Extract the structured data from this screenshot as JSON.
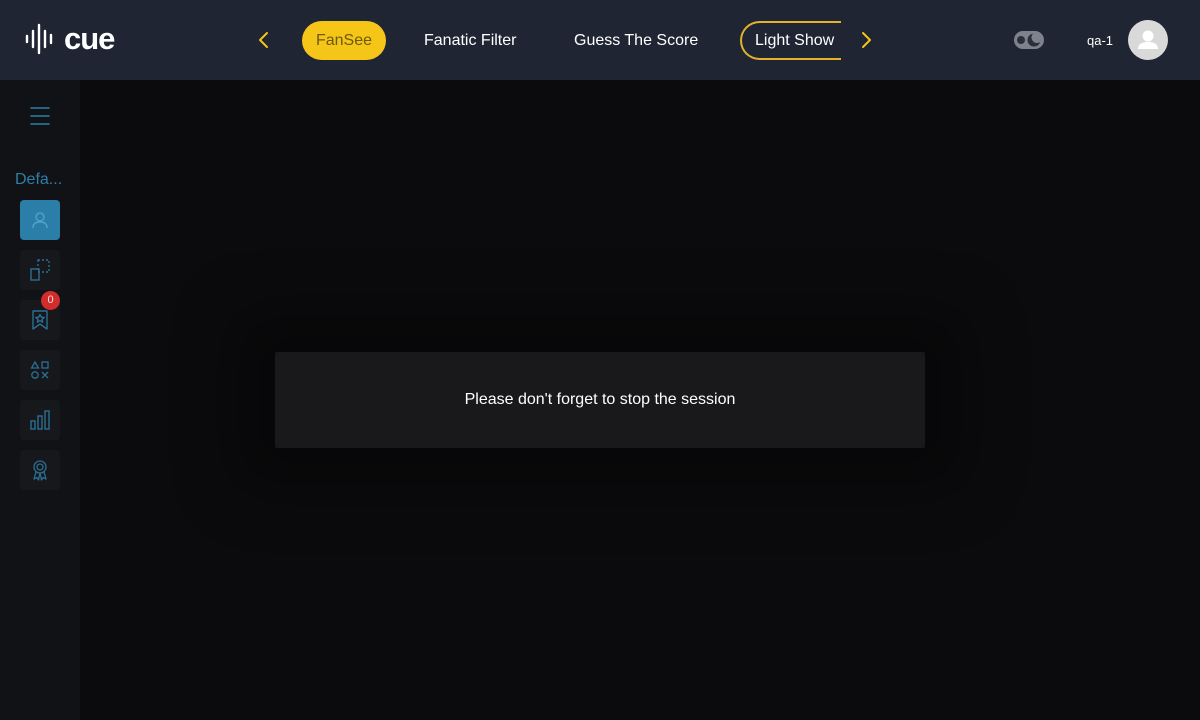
{
  "brand": {
    "logo_text": "cue"
  },
  "header": {
    "tabs": [
      {
        "label": "FanSee",
        "state": "active"
      },
      {
        "label": "Fanatic Filter",
        "state": "default"
      },
      {
        "label": "Guess The Score",
        "state": "default"
      },
      {
        "label": "Light Show",
        "state": "outlined"
      }
    ],
    "prev_icon": "chevron-left-icon",
    "next_icon": "chevron-right-icon",
    "theme_toggle_icon": "moon-icon",
    "username": "qa-1",
    "avatar_icon": "user-icon"
  },
  "sidebar": {
    "menu_icon": "hamburger-icon",
    "title": "Defa...",
    "items": [
      {
        "icon": "user-icon",
        "active": true
      },
      {
        "icon": "screen-switch-icon",
        "active": false
      },
      {
        "icon": "bookmark-star-icon",
        "active": false,
        "badge": "0"
      },
      {
        "icon": "shapes-icon",
        "active": false
      },
      {
        "icon": "bar-chart-icon",
        "active": false
      },
      {
        "icon": "award-icon",
        "active": false
      }
    ]
  },
  "dialog": {
    "message": "Please don't forget to stop the session"
  },
  "colors": {
    "accent_yellow": "#f5c518",
    "topbar": "#1f2533",
    "sidebar_accent": "#2b7ea8",
    "badge_red": "#d22c2c",
    "dialog_bg": "#19191b"
  }
}
